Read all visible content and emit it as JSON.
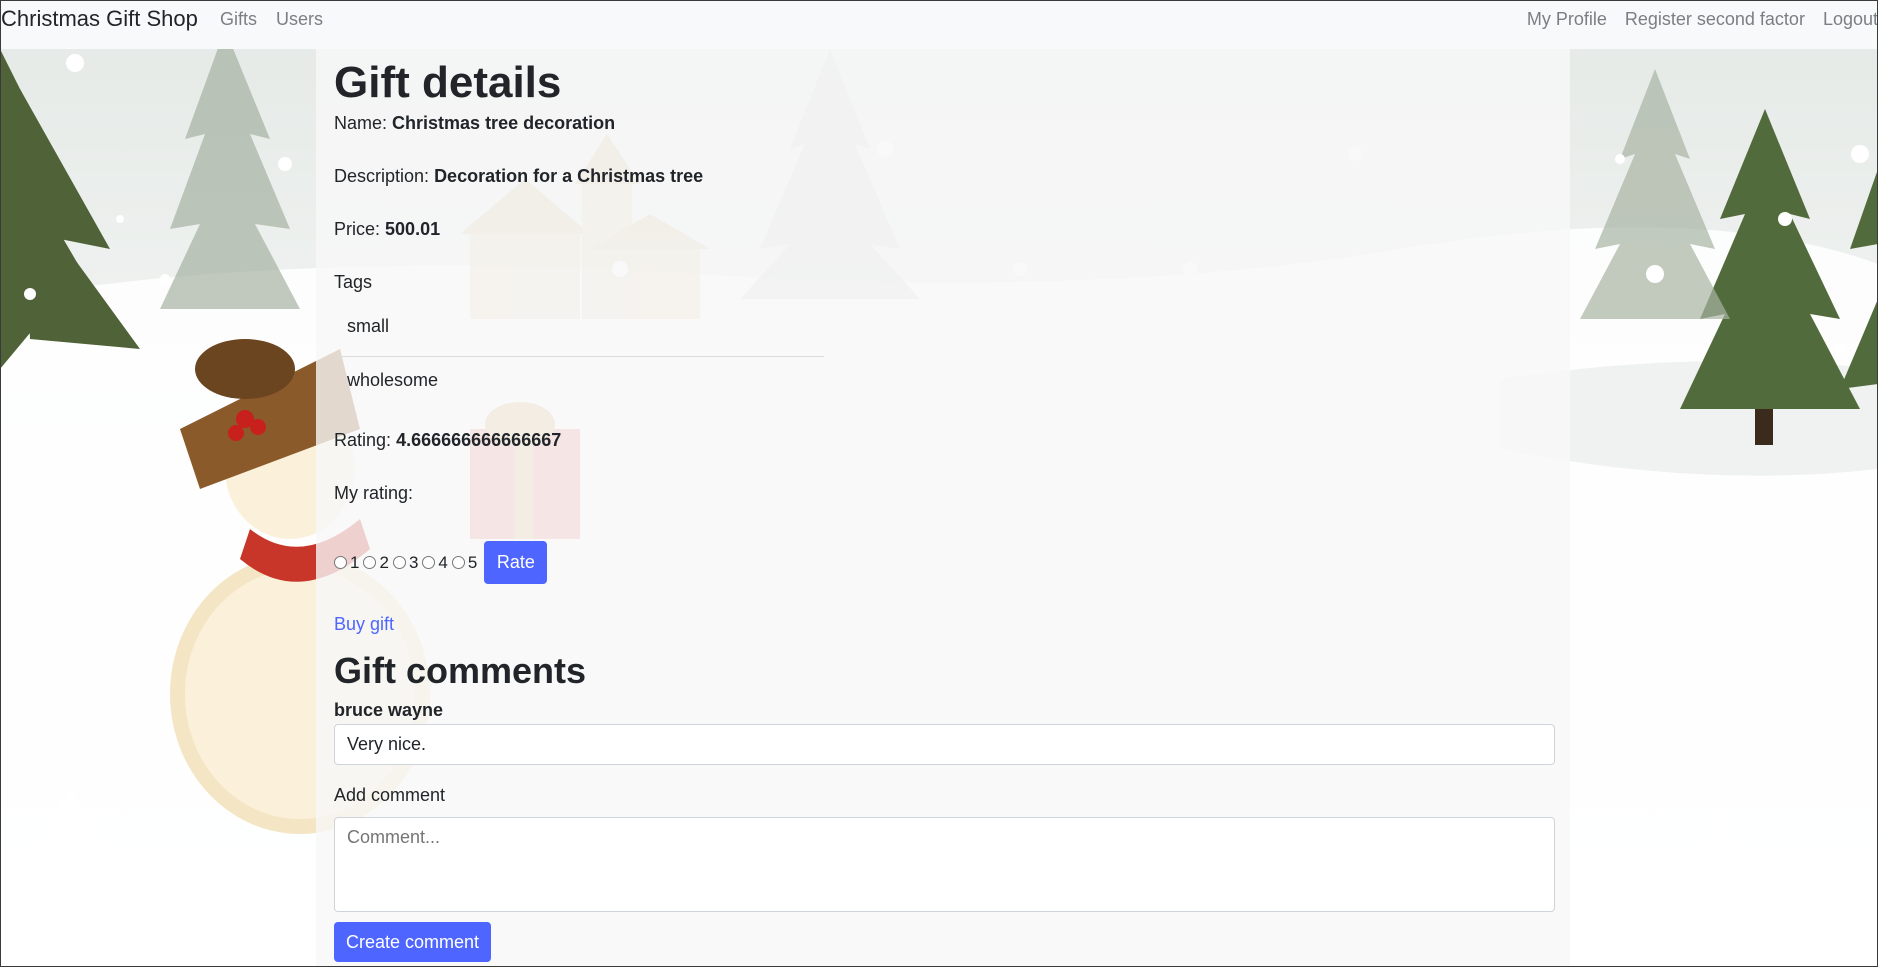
{
  "navbar": {
    "brand": "Christmas Gift Shop",
    "left_links": [
      "Gifts",
      "Users"
    ],
    "right_links": [
      "My Profile",
      "Register second factor",
      "Logout"
    ]
  },
  "gift": {
    "heading": "Gift details",
    "name_label": "Name:",
    "name": "Christmas tree decoration",
    "description_label": "Description:",
    "description": "Decoration for a Christmas tree",
    "price_label": "Price:",
    "price": "500.01",
    "tags_label": "Tags",
    "tags": [
      "small",
      "wholesome"
    ],
    "rating_label": "Rating:",
    "rating": "4.666666666666667",
    "my_rating_label": "My rating:",
    "rating_options": [
      "1",
      "2",
      "3",
      "4",
      "5"
    ],
    "rate_button": "Rate",
    "buy_link": "Buy gift"
  },
  "comments": {
    "heading": "Gift comments",
    "items": [
      {
        "author": "bruce wayne",
        "text": "Very nice."
      }
    ],
    "add_label": "Add comment",
    "placeholder": "Comment...",
    "create_button": "Create comment"
  },
  "colors": {
    "accent": "#4e66ff",
    "navbar_bg": "#f8f9fa",
    "nav_link": "#7a7f84"
  }
}
